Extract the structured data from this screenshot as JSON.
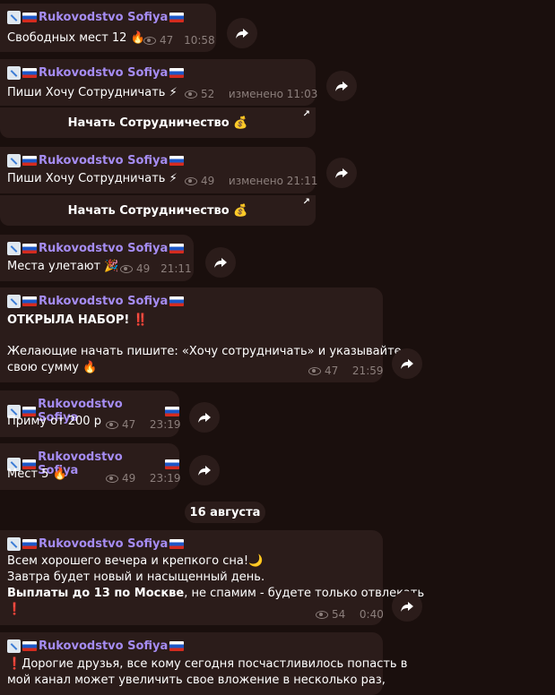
{
  "channel_name": "Rukovodstvo Sofiya",
  "messages": [
    {
      "text": "Свободных мест 12",
      "emoji": "🔥",
      "views": "47",
      "time": "10:58"
    },
    {
      "text": "Пиши Хочу Сотрудничать",
      "emoji": "⚡",
      "views": "52",
      "time": "изменено 11:03",
      "button": "Начать Сотрудничество",
      "button_emoji": "💰"
    },
    {
      "text": "Пиши Хочу Сотрудничать",
      "emoji": "⚡",
      "views": "49",
      "time": "изменено 21:11",
      "button": "Начать Сотрудничество",
      "button_emoji": "💰"
    },
    {
      "text": "Места улетают",
      "emoji": "🎉",
      "views": "49",
      "time": "21:11"
    },
    {
      "title": "ОТКРЫЛА НАБОР!",
      "title_emoji": "‼️",
      "line2": "Желающие начать пишите: «Хочу сотрудничать» и указывайте",
      "line3": "свою сумму",
      "emoji": "🔥",
      "views": "47",
      "time": "21:59"
    },
    {
      "text": "Приму от 200 р",
      "views": "47",
      "time": "23:19"
    },
    {
      "text": "Мест 5",
      "emoji": "🔥",
      "views": "49",
      "time": "23:19"
    },
    {
      "line1": "Всем хорошего вечера и крепкого сна!",
      "line1_emoji": "🌙",
      "line2": "Завтра будет новый и насыщенный день.",
      "line3_bold": "Выплаты до 13 по Москве",
      "line3_rest": ", не спамим - будете только отвлекать",
      "line4_emoji": "❗",
      "views": "54",
      "time": "0:40"
    },
    {
      "line1": "Дорогие друзья, все кому сегодня посчастливилось попасть в",
      "line1_emoji": "❗",
      "line2": "мой канал может увеличить свое вложение в несколько раз,"
    }
  ],
  "date_separator": "16 августа"
}
